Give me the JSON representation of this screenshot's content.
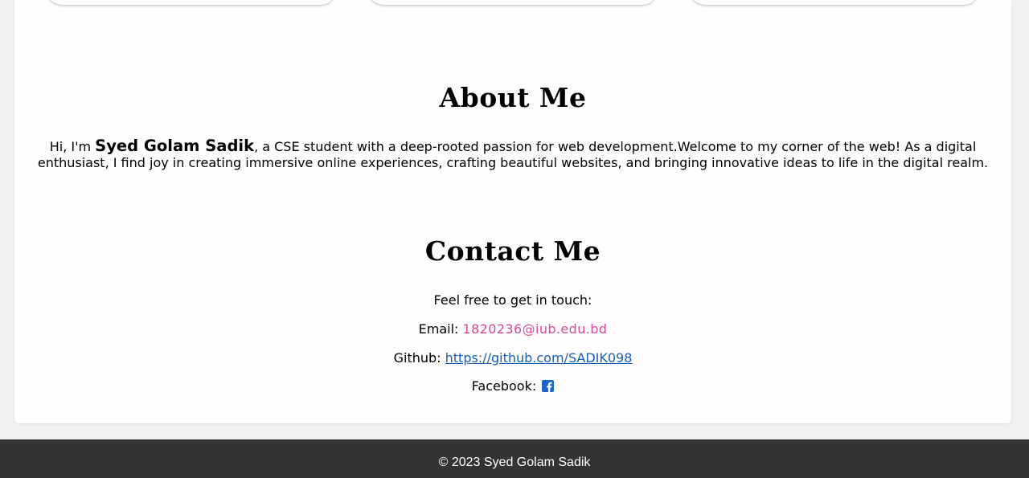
{
  "about": {
    "title": "About Me",
    "greeting": "Hi, I'm ",
    "name": "Syed Golam Sadik",
    "description": ", a CSE student with a deep-rooted passion for web development.Welcome to my corner of the web! As a digital enthusiast, I find joy in creating immersive online experiences, crafting beautiful websites, and bringing innovative ideas to life in the digital realm."
  },
  "contact": {
    "title": "Contact Me",
    "intro": "Feel free to get in touch:",
    "email_label": "Email: ",
    "email": "1820236@iub.edu.bd",
    "github_label": "Github: ",
    "github_url": "https://github.com/SADIK098",
    "facebook_label": "Facebook: ",
    "facebook_icon": "facebook-square-icon"
  },
  "footer": {
    "copyright": "© 2023 Syed Golam Sadik"
  },
  "colors": {
    "email_link": "#d6489a",
    "github_link": "#1a5fb4",
    "facebook_icon": "#1b66c9",
    "footer_bg": "#333333"
  }
}
